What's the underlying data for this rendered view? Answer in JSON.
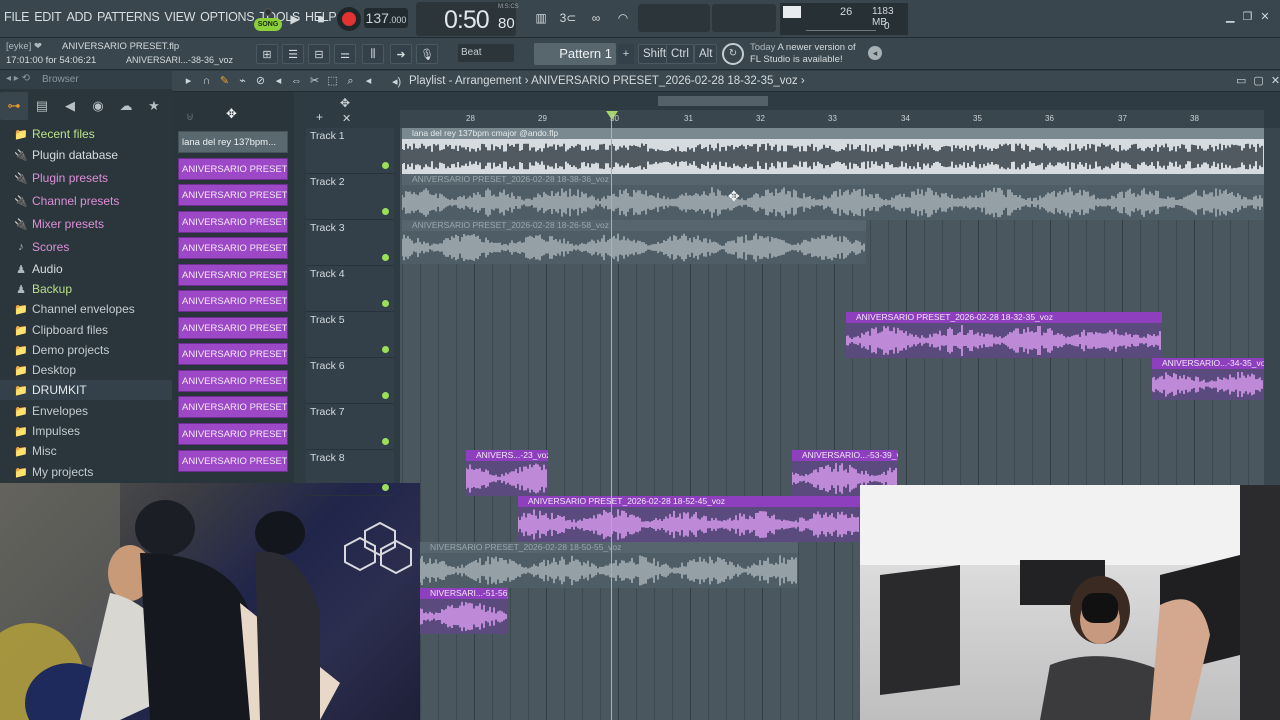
{
  "menu": [
    "FILE",
    "EDIT",
    "ADD",
    "PATTERNS",
    "VIEW",
    "OPTIONS",
    "TOOLS",
    "HELP"
  ],
  "transport": {
    "song_label": "SONG",
    "tempo": "137",
    "tempo_dec": ".000",
    "time": "0:50",
    "time_frac": "80",
    "time_label": "M:S:CS"
  },
  "cpu": {
    "value": "26",
    "ram": "1183 MB",
    "poly": "0"
  },
  "window_controls": [
    "▁",
    "❐",
    "✕"
  ],
  "project": {
    "user": "[eyke] ❤",
    "file": "ANIVERSARIO PRESET.flp",
    "session": "17:01:00 for 54:06:21",
    "clip": "ANIVERSARI...-38-36_voz"
  },
  "snap": "Beat",
  "pattern": "Pattern 1",
  "mod_keys": [
    "Shift",
    "Ctrl",
    "Alt"
  ],
  "news": {
    "prefix": "Today",
    "line1": "A newer version of",
    "line2": "FL Studio is available!"
  },
  "browser": {
    "title": "Browser",
    "items": [
      {
        "label": "Recent files",
        "icon": "📁",
        "style": "green"
      },
      {
        "label": "Plugin database",
        "icon": "🔌",
        "style": "strong"
      },
      {
        "label": "Plugin presets",
        "icon": "🔌",
        "style": "pink"
      },
      {
        "label": "Channel presets",
        "icon": "🔌",
        "style": "pink"
      },
      {
        "label": "Mixer presets",
        "icon": "🔌",
        "style": "pink"
      },
      {
        "label": "Scores",
        "icon": "♪",
        "style": "pink"
      },
      {
        "label": "Audio",
        "icon": "♟",
        "style": "strong"
      },
      {
        "label": "Backup",
        "icon": "♟",
        "style": "green"
      },
      {
        "label": "Channel envelopes",
        "icon": "📁",
        "style": ""
      },
      {
        "label": "Clipboard files",
        "icon": "📁",
        "style": ""
      },
      {
        "label": "Demo projects",
        "icon": "📁",
        "style": ""
      },
      {
        "label": "Desktop",
        "icon": "📁",
        "style": ""
      },
      {
        "label": "DRUMKIT",
        "icon": "📁",
        "style": "sel"
      },
      {
        "label": "Envelopes",
        "icon": "📁",
        "style": ""
      },
      {
        "label": "Impulses",
        "icon": "📁",
        "style": ""
      },
      {
        "label": "Misc",
        "icon": "📁",
        "style": ""
      },
      {
        "label": "My projects",
        "icon": "📁",
        "style": ""
      }
    ]
  },
  "playlist": {
    "title": "Playlist - Arrangement",
    "arrangement": "ANIVERSARIO PRESET_2026-02-28 18-32-35_voz"
  },
  "clip_list": [
    "lana del rey 137bpm...",
    "ANIVERSARIO PRESET_202...",
    "ANIVERSARIO PRESET_202...",
    "ANIVERSARIO PRESET_202...",
    "ANIVERSARIO PRESET_202...",
    "ANIVERSARIO PRESET_202...",
    "ANIVERSARIO PRESET_202...",
    "ANIVERSARIO PRESET_202...",
    "ANIVERSARIO PRESET_202...",
    "ANIVERSARIO PRESET_202...",
    "ANIVERSARIO PRESET_202...",
    "ANIVERSARIO PRESET_202...",
    "ANIVERSARIO PRESET_202..."
  ],
  "tracks": [
    "Track 1",
    "Track 2",
    "Track 3",
    "Track 4",
    "Track 5",
    "Track 6",
    "Track 7",
    "Track 8"
  ],
  "ruler": [
    "28",
    "29",
    "30",
    "31",
    "32",
    "33",
    "34",
    "35",
    "36",
    "37",
    "38"
  ],
  "clips": [
    {
      "label": "lana del rey 137bpm cmajor @ando.flp",
      "style": "white"
    },
    {
      "label": "ANIVERSARIO PRESET_2026-02-28 18-38-36_voz",
      "style": "gray"
    },
    {
      "label": "ANIVERSARIO PRESET_2026-02-28 18-26-58_voz",
      "style": "gray"
    },
    {
      "label": "ANIVERSARIO PRESET_2026-02-28 18-32-35_voz",
      "style": "purple"
    },
    {
      "label": "ANIVERSARIO...-34-35_voz",
      "style": "purple"
    },
    {
      "label": "ANIVERS...-23_voz",
      "style": "purple"
    },
    {
      "label": "ANIVERSARIO...-53-39_voz",
      "style": "purple"
    },
    {
      "label": "ANIVERSARIO PRESET_2026-02-28 18-52-45_voz",
      "style": "purple"
    },
    {
      "label": "NIVERSARIO PRESET_2026-02-28 18-50-55_voz",
      "style": "gray"
    },
    {
      "label": "NIVERSARI...-51-56_voz",
      "style": "purple"
    }
  ]
}
